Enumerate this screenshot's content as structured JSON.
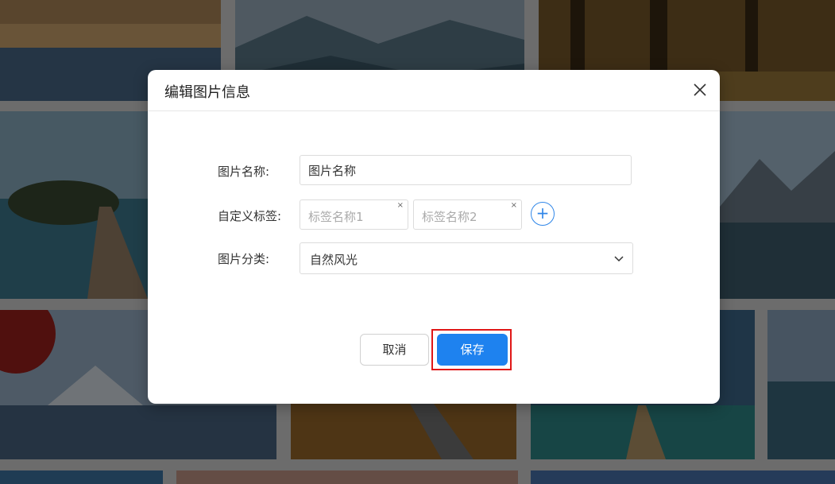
{
  "dialog": {
    "title": "编辑图片信息",
    "close_icon": "close-icon"
  },
  "form": {
    "name_label": "图片名称:",
    "name_value": "图片名称",
    "tags_label": "自定义标签:",
    "tags": [
      {
        "placeholder": "标签名称1"
      },
      {
        "placeholder": "标签名称2"
      }
    ],
    "tag_remove_glyph": "×",
    "add_tag_glyph": "+",
    "category_label": "图片分类:",
    "category_value": "自然风光"
  },
  "actions": {
    "cancel_label": "取消",
    "save_label": "保存"
  },
  "colors": {
    "accent": "#1e82ef",
    "highlight_border": "#e01717",
    "overlay": "rgba(0,0,0,0.5)"
  }
}
